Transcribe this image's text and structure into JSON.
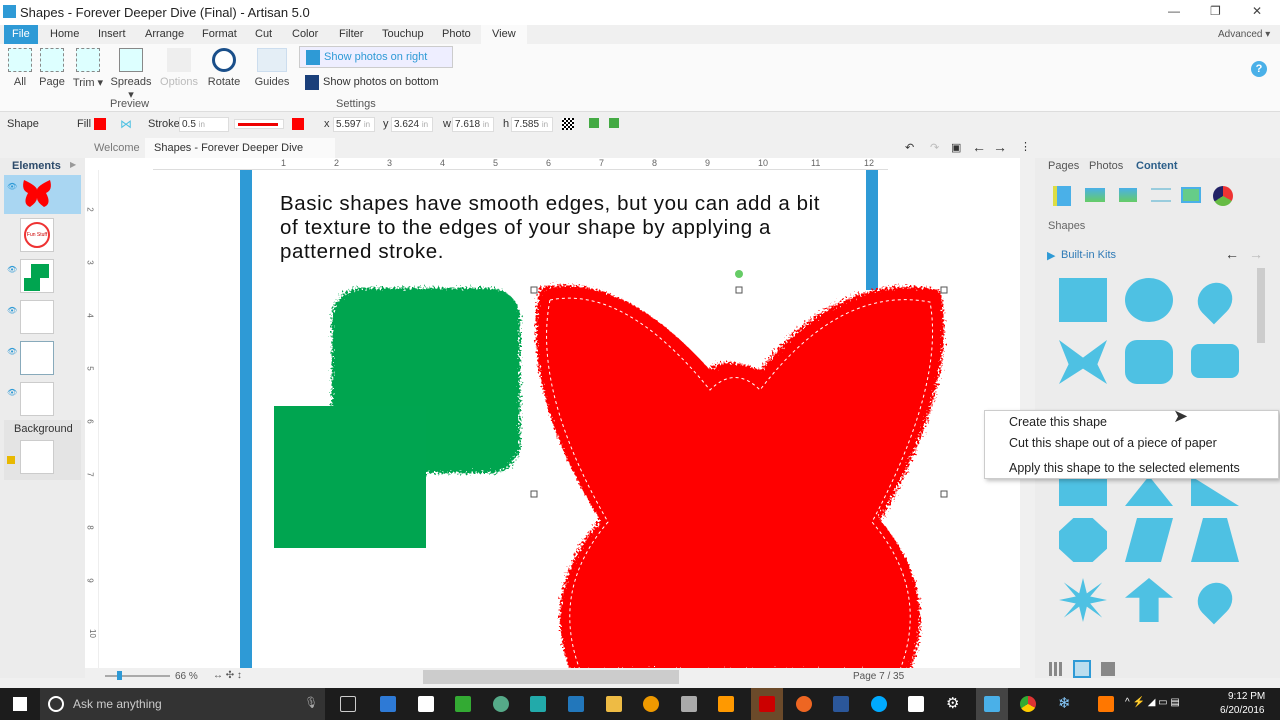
{
  "window": {
    "title": "Shapes - Forever Deeper Dive (Final) - Artisan 5.0",
    "minimize": "—",
    "restore": "❐",
    "close": "✕"
  },
  "menu": {
    "tabs": [
      "File",
      "Home",
      "Insert",
      "Arrange",
      "Format",
      "Cut",
      "Color",
      "Filter",
      "Touchup",
      "Photo",
      "View"
    ],
    "active": "View",
    "advanced": "Advanced ▾",
    "help": "?"
  },
  "ribbon": {
    "buttons": [
      "All",
      "Page",
      "Trim ▾",
      "Spreads ▾",
      "Options",
      "Rotate",
      "Guides"
    ],
    "show_right": "Show photos on right",
    "show_bottom": "Show photos on bottom",
    "group_preview": "Preview",
    "group_settings": "Settings"
  },
  "shapebar": {
    "label": "Shape",
    "fill": "Fill",
    "stroke": "Stroke",
    "stroke_width": "0.5",
    "unit": "in",
    "x_label": "x",
    "x": "5.597",
    "y_label": "y",
    "y": "3.624",
    "w_label": "w",
    "w": "7.618",
    "h_label": "h",
    "h": "7.585",
    "fill_color": "#ff0000",
    "stroke_color": "#ff0000"
  },
  "doc_tabs": [
    "Welcome",
    "Shapes - Forever Deeper Dive (Fi..."
  ],
  "left_panel": {
    "title": "Elements",
    "background": "Background",
    "thumb_text": "Fun Stuff"
  },
  "ruler": {
    "h": [
      "1",
      "2",
      "3",
      "4",
      "5",
      "6",
      "7",
      "8",
      "9",
      "10",
      "11",
      "12"
    ],
    "v": [
      "2",
      "3",
      "4",
      "5",
      "6",
      "7",
      "8",
      "9",
      "10"
    ]
  },
  "page": {
    "text": "Basic shapes have smooth edges, but you can add a bit of texture to the edges of your shape by applying a patterned stroke."
  },
  "right_panel": {
    "tabs": [
      "Pages",
      "Photos",
      "Content"
    ],
    "active": "Content",
    "section": "Shapes",
    "kits": "Built-in Kits"
  },
  "context_menu": [
    "Create this shape",
    "Cut this shape out of a piece of paper",
    "Apply this shape to the selected elements"
  ],
  "status": {
    "zoom": "66 %",
    "page": "Page 7 / 35"
  },
  "taskbar": {
    "search": "Ask me anything",
    "time": "9:12 PM",
    "date": "6/20/2016"
  },
  "colors": {
    "accent": "#2e9ad6",
    "shape_red": "#ff0000",
    "shape_green": "#00a550",
    "shape_blue": "#4ec1e3"
  }
}
